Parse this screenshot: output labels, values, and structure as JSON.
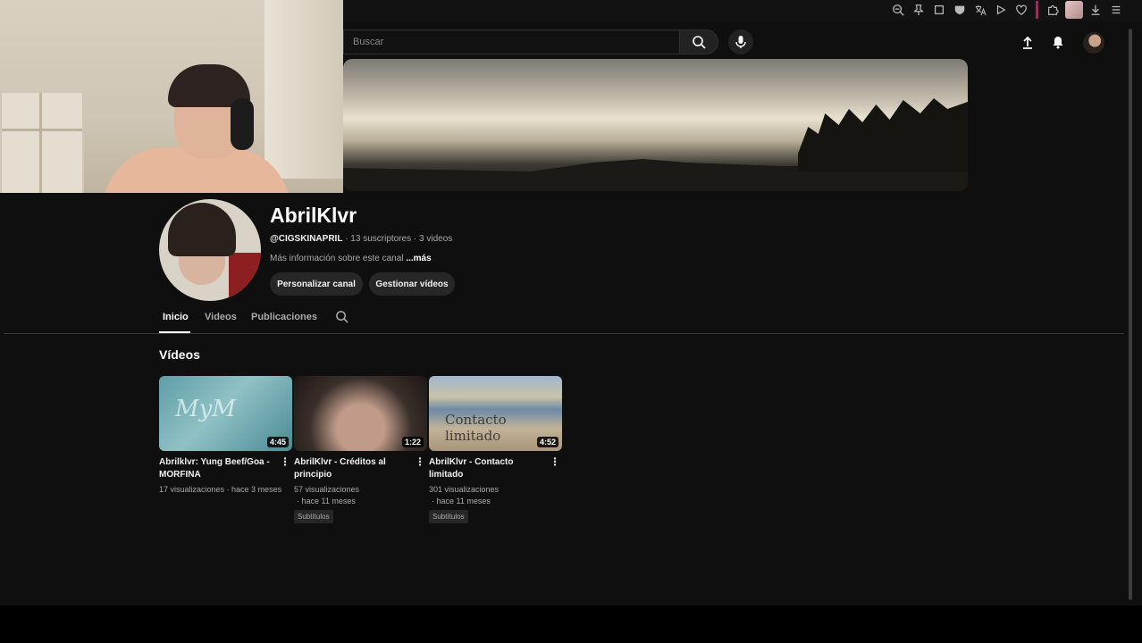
{
  "search": {
    "placeholder": "Buscar"
  },
  "channel": {
    "name": "AbrilKlvr",
    "handle": "@CIGSKINAPRIL",
    "meta": " · 13 suscriptores · 3 videos",
    "info": "Más información sobre este canal",
    "more": "...más",
    "customize_label": "Personalizar canal",
    "manage_label": "Gestionar vídeos"
  },
  "tabs": [
    {
      "label": "Inicio",
      "active": true
    },
    {
      "label": "Videos",
      "active": false
    },
    {
      "label": "Publicaciones",
      "active": false
    }
  ],
  "section_title": "Vídeos",
  "videos": [
    {
      "title": "Abrilklvr: Yung Beef/Goa - MORFINA",
      "duration": "4:45",
      "meta1": "17 visualizaciones · hace 3 meses",
      "meta2": "",
      "badge": ""
    },
    {
      "title": "AbrilKlvr - Créditos al principio",
      "duration": "1:22",
      "meta1": "57 visualizaciones",
      "meta2": "· hace 11 meses",
      "badge": "Subtítulos"
    },
    {
      "title": "AbrilKlvr - Contacto limitado",
      "duration": "4:52",
      "meta1": "301 visualizaciones",
      "meta2": "· hace 11 meses",
      "badge": "Subtítulos"
    }
  ],
  "icons": {
    "browser_bar": [
      "zoom-out-icon",
      "pin-icon",
      "crop-icon",
      "shield-icon",
      "translate-icon",
      "play-icon",
      "heart-icon",
      "puzzle-icon",
      "download-icon",
      "menu-icon"
    ],
    "topbar": [
      "upload-icon",
      "bell-icon"
    ]
  },
  "colors": {
    "background": "#0f0f0f",
    "text": "#f1f1f1",
    "muted": "#aaaaaa",
    "pill": "#272727",
    "accent_separator": "#c2185b"
  }
}
